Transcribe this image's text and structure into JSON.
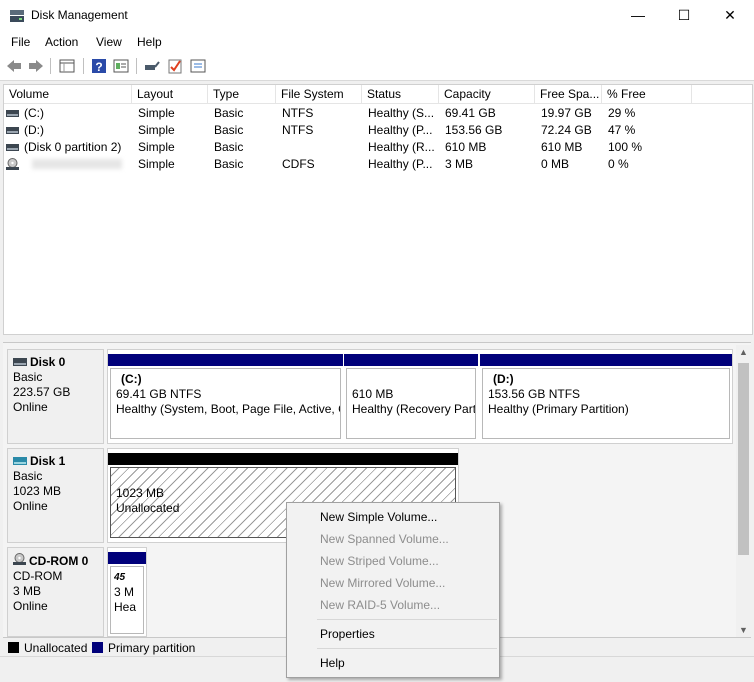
{
  "window": {
    "title": "Disk Management",
    "minimize": "—",
    "maximize": "☐",
    "close": "✕"
  },
  "menubar": {
    "items": [
      "File",
      "Action",
      "View",
      "Help"
    ]
  },
  "toolbar": {
    "icons": [
      "back-icon",
      "forward-icon",
      "list-view-icon",
      "help-icon",
      "properties-icon",
      "connect-icon",
      "check-icon",
      "settings-icon"
    ]
  },
  "volume_list": {
    "columns": [
      "Volume",
      "Layout",
      "Type",
      "File System",
      "Status",
      "Capacity",
      "Free Spa...",
      "% Free"
    ],
    "rows": [
      [
        "(C:)",
        "Simple",
        "Basic",
        "NTFS",
        "Healthy (S...",
        "69.41 GB",
        "19.97 GB",
        "29 %"
      ],
      [
        "(D:)",
        "Simple",
        "Basic",
        "NTFS",
        "Healthy (P...",
        "153.56 GB",
        "72.24 GB",
        "47 %"
      ],
      [
        "(Disk 0 partition 2)",
        "Simple",
        "Basic",
        "",
        "Healthy (R...",
        "610 MB",
        "610 MB",
        "100 %"
      ],
      [
        "",
        "Simple",
        "Basic",
        "CDFS",
        "Healthy (P...",
        "3 MB",
        "0 MB",
        "0 %"
      ]
    ]
  },
  "disks": [
    {
      "name": "Disk 0",
      "type": "Basic",
      "size": "223.57 GB",
      "status": "Online",
      "partitions": [
        {
          "label": "(C:)",
          "size": "69.41 GB NTFS",
          "status": "Healthy (System, Boot, Page File, Active, C"
        },
        {
          "label": "",
          "size": "610 MB",
          "status": "Healthy (Recovery Part"
        },
        {
          "label": "(D:)",
          "size": "153.56 GB NTFS",
          "status": "Healthy (Primary Partition)"
        }
      ]
    },
    {
      "name": "Disk 1",
      "type": "Basic",
      "size": "1023 MB",
      "status": "Online",
      "partitions": [
        {
          "size": "1023 MB",
          "status": "Unallocated"
        }
      ]
    },
    {
      "name": "CD-ROM 0",
      "type": "CD-ROM",
      "size": "3 MB",
      "status": "Online",
      "partitions": [
        {
          "size": "3 M",
          "status": "Hea"
        }
      ]
    }
  ],
  "legend": {
    "unallocated": "Unallocated",
    "primary": "Primary partition",
    "unallocated_color": "#000000",
    "primary_color": "#00007a"
  },
  "context_menu": {
    "items": [
      {
        "label": "New Simple Volume...",
        "enabled": true
      },
      {
        "label": "New Spanned Volume...",
        "enabled": false
      },
      {
        "label": "New Striped Volume...",
        "enabled": false
      },
      {
        "label": "New Mirrored Volume...",
        "enabled": false
      },
      {
        "label": "New RAID-5 Volume...",
        "enabled": false
      },
      {
        "label": "Properties",
        "enabled": true
      },
      {
        "label": "Help",
        "enabled": true
      }
    ]
  }
}
